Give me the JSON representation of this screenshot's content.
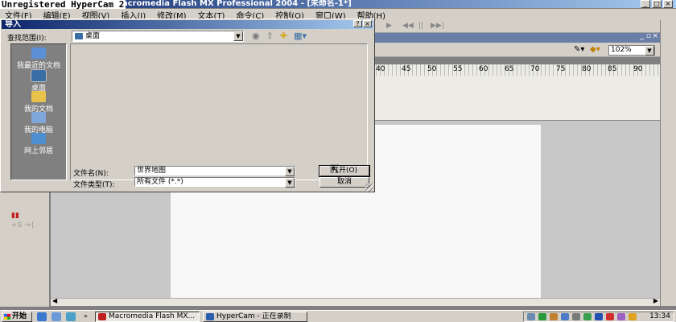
{
  "app": {
    "title": "Macromedia Flash MX Professional 2004 - [未命名-1*]",
    "watermark": "Unregistered HyperCam 2"
  },
  "menu": [
    "文件(F)",
    "编辑(E)",
    "视图(V)",
    "插入(I)",
    "修改(M)",
    "文本(T)",
    "命令(C)",
    "控制(O)",
    "窗口(W)",
    "帮助(H)"
  ],
  "window_controls": {
    "min": "_",
    "max": "□",
    "close": "×"
  },
  "workspace": {
    "zoom": "102%"
  },
  "timeline": {
    "ruler_numbers": [
      "40",
      "45",
      "50",
      "55",
      "60",
      "65",
      "70",
      "75",
      "80",
      "85",
      "90"
    ]
  },
  "dialog": {
    "title": "导入",
    "help": "?",
    "close": "×",
    "look_in_label": "查找范围(I):",
    "look_in_value": "桌面",
    "places": [
      {
        "label": "我最近的文档",
        "color": "#5b8fd6"
      },
      {
        "label": "桌面",
        "color": "#3a6ea5"
      },
      {
        "label": "我的文档",
        "color": "#e8c24a"
      },
      {
        "label": "我的电脑",
        "color": "#7fa7d9"
      },
      {
        "label": "网上邻居",
        "color": "#4d8fcf"
      }
    ],
    "file_name_label": "文件名(N):",
    "file_name_value": "世界地图",
    "file_type_label": "文件类型(T):",
    "file_type_value": "所有文件 (*.*)",
    "open_button": "打开(O)",
    "cancel_button": "取消"
  },
  "taskbar": {
    "start": "开始",
    "tasks": [
      {
        "label": "Macromedia Flash MX...",
        "color": "#c02020"
      },
      {
        "label": "HyperCam - 正在录制",
        "color": "#2a5cb0"
      }
    ],
    "clock": "13:34"
  }
}
